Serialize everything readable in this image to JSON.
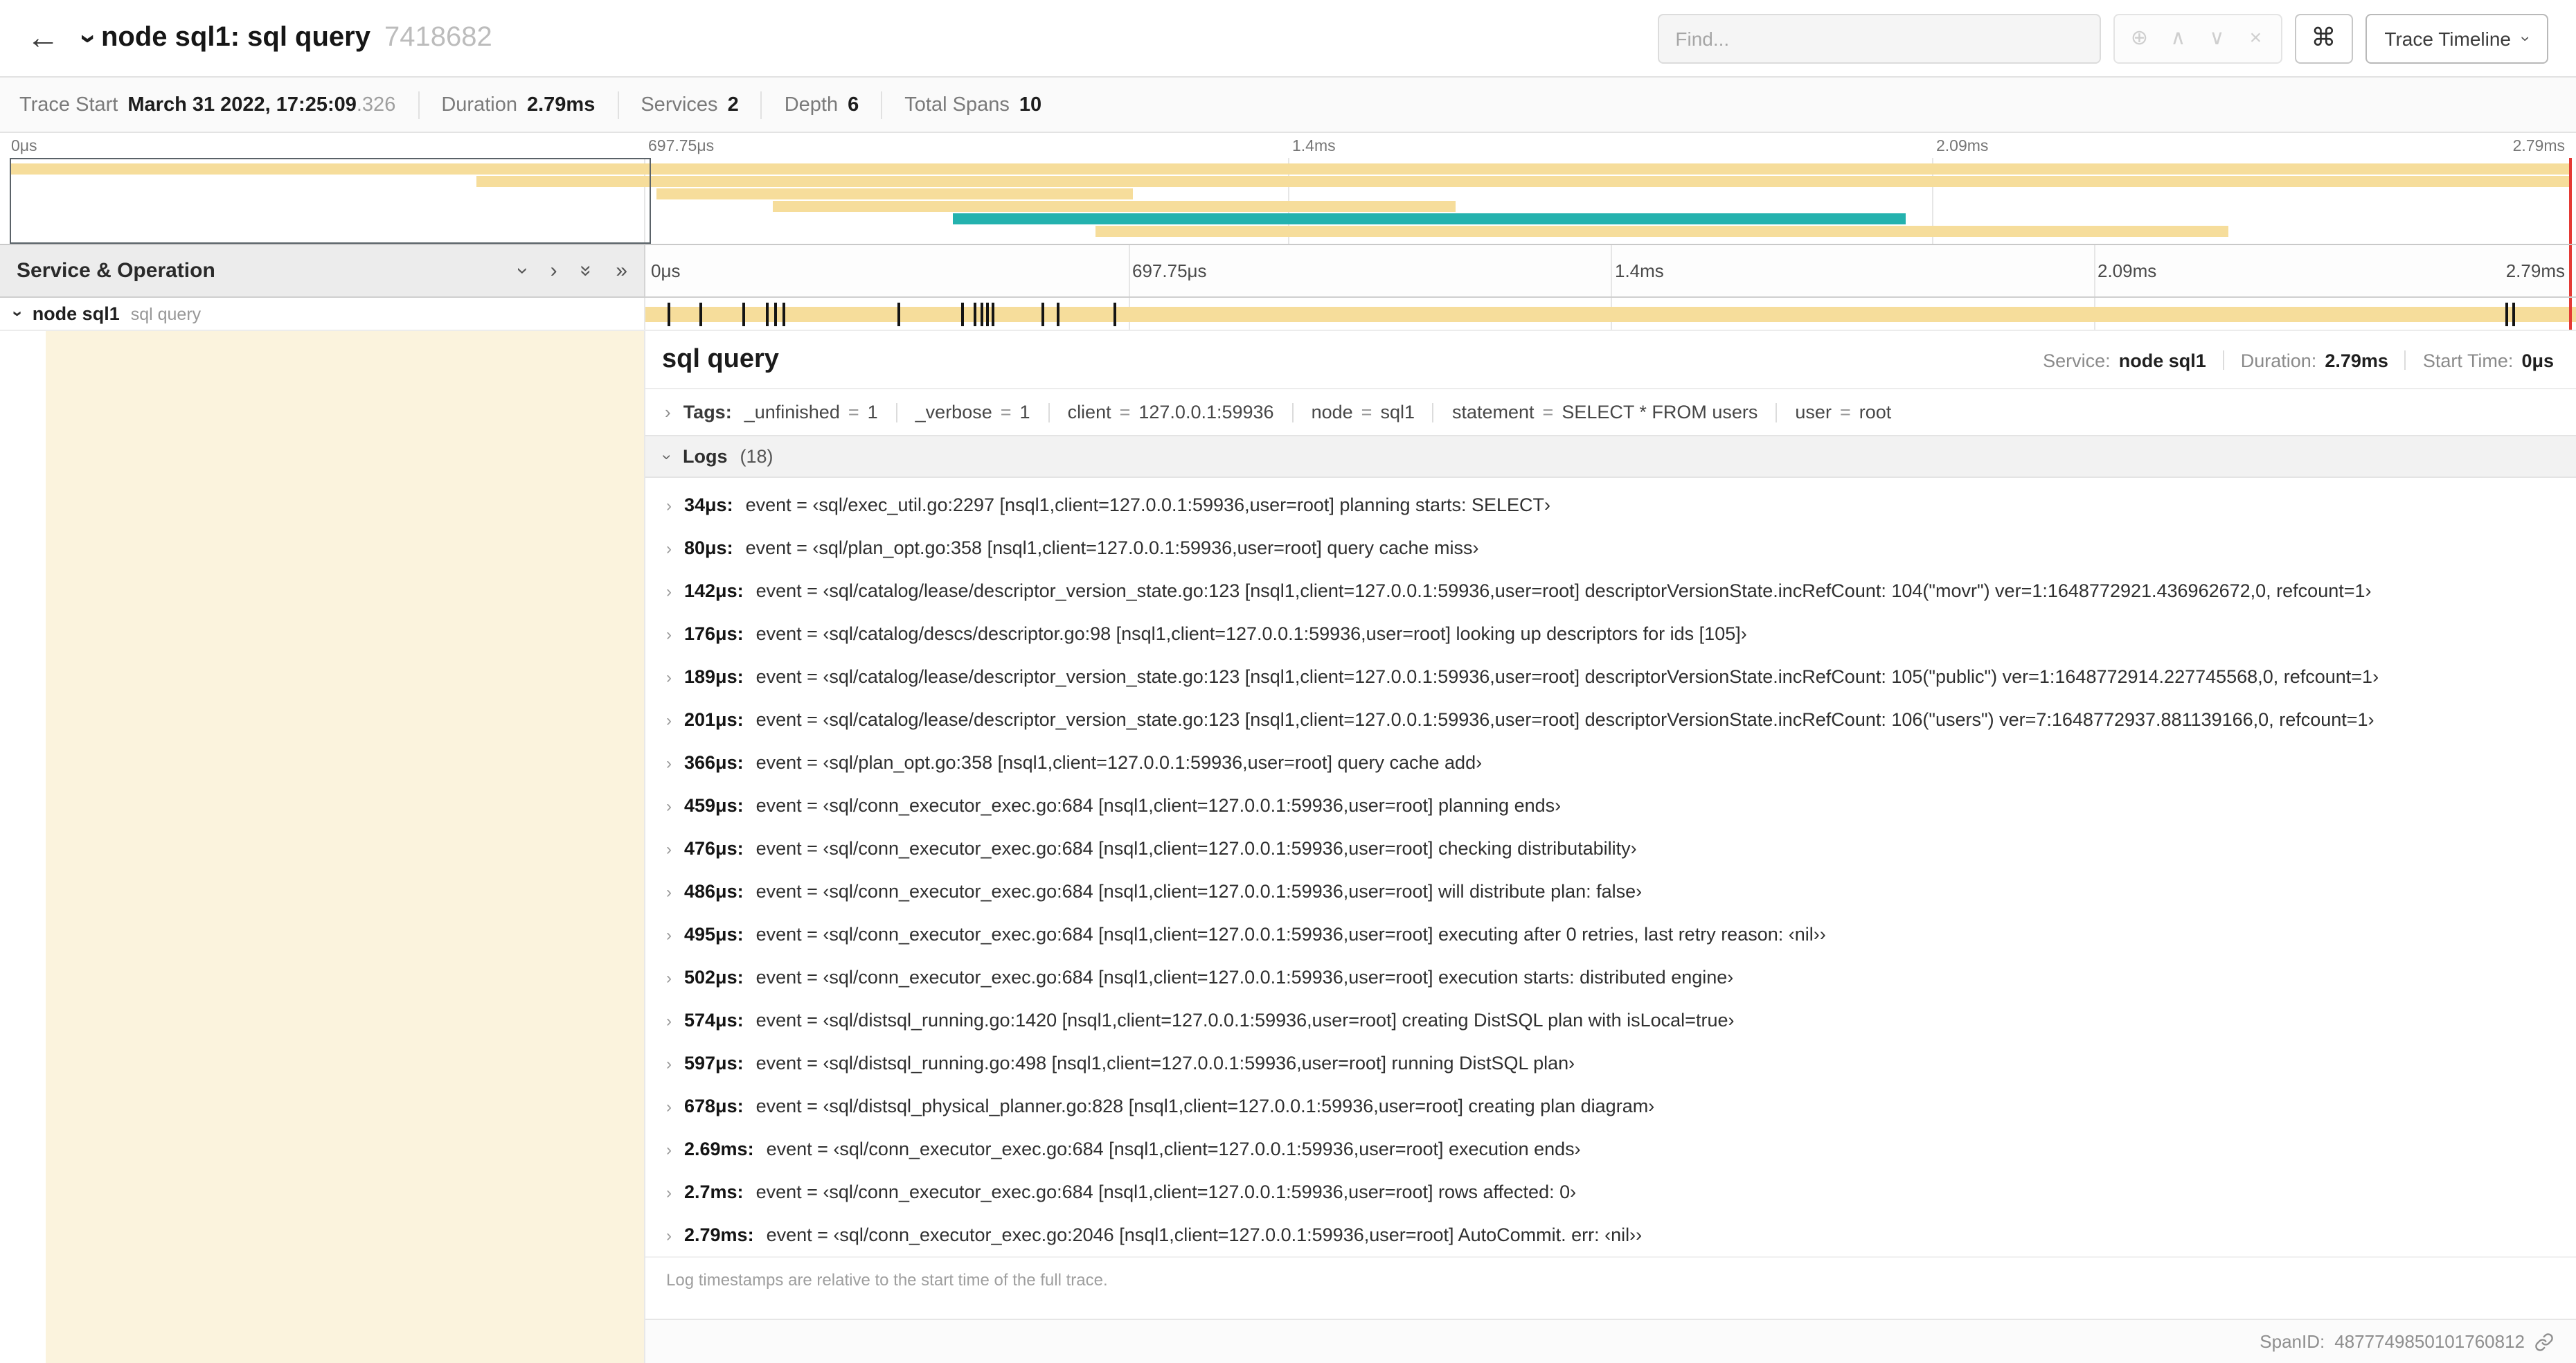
{
  "header": {
    "title": "node sql1: sql query",
    "trace_id": "7418682",
    "find_placeholder": "Find...",
    "trace_timeline_label": "Trace Timeline"
  },
  "icons": {
    "back": "←",
    "chevron": "›",
    "double_chevron": "»",
    "focus": "⊕",
    "prev_match": "∧",
    "next_match": "∨",
    "clear_search": "×",
    "command": "⌘"
  },
  "summary": {
    "items": [
      {
        "label": "Trace Start",
        "value": "March 31 2022, 17:25:09",
        "suffix": ".326"
      },
      {
        "label": "Duration",
        "value": "2.79ms"
      },
      {
        "label": "Services",
        "value": "2"
      },
      {
        "label": "Depth",
        "value": "6"
      },
      {
        "label": "Total Spans",
        "value": "10"
      }
    ]
  },
  "minimap": {
    "ticks": [
      "0μs",
      "697.75μs",
      "1.4ms",
      "2.09ms",
      "2.79ms"
    ],
    "viewport": {
      "start": 0.004,
      "end": 0.2525
    },
    "scrubber": 0.9975,
    "bars": [
      {
        "row": 0,
        "start": 0.004,
        "end": 0.998,
        "color": "tan"
      },
      {
        "row": 1,
        "start": 0.185,
        "end": 0.998,
        "color": "tan"
      },
      {
        "row": 2,
        "start": 0.255,
        "end": 0.44,
        "color": "tan"
      },
      {
        "row": 3,
        "start": 0.3,
        "end": 0.565,
        "color": "tan"
      },
      {
        "row": 4,
        "start": 0.37,
        "end": 0.74,
        "color": "teal"
      },
      {
        "row": 5,
        "start": 0.425,
        "end": 0.865,
        "color": "tan"
      }
    ]
  },
  "timeline": {
    "panel_title": "Service & Operation",
    "ticks": [
      "0μs",
      "697.75μs",
      "1.4ms",
      "2.09ms",
      "2.79ms"
    ],
    "duration_us": 2790,
    "span_row": {
      "service": "node sql1",
      "operation": "sql query",
      "marker_times_us": [
        34,
        80,
        142,
        176,
        189,
        201,
        366,
        459,
        476,
        486,
        495,
        502,
        574,
        597,
        678,
        2690,
        2700,
        2790
      ]
    }
  },
  "detail": {
    "title": "sql query",
    "meta": [
      {
        "label": "Service:",
        "value": "node sql1"
      },
      {
        "label": "Duration:",
        "value": "2.79ms"
      },
      {
        "label": "Start Time:",
        "value": "0μs"
      }
    ],
    "tags_label": "Tags:",
    "tags": [
      {
        "key": "_unfinished",
        "value": "1"
      },
      {
        "key": "_verbose",
        "value": "1"
      },
      {
        "key": "client",
        "value": "127.0.0.1:59936"
      },
      {
        "key": "node",
        "value": "sql1"
      },
      {
        "key": "statement",
        "value": "SELECT * FROM users"
      },
      {
        "key": "user",
        "value": "root"
      }
    ],
    "logs_label": "Logs",
    "logs_count": "(18)",
    "logs": [
      {
        "time": "34μs:",
        "text": "event = ‹sql/exec_util.go:2297 [nsql1,client=127.0.0.1:59936,user=root] planning starts: SELECT›"
      },
      {
        "time": "80μs:",
        "text": "event = ‹sql/plan_opt.go:358 [nsql1,client=127.0.0.1:59936,user=root] query cache miss›"
      },
      {
        "time": "142μs:",
        "text": "event = ‹sql/catalog/lease/descriptor_version_state.go:123 [nsql1,client=127.0.0.1:59936,user=root] descriptorVersionState.incRefCount: 104(\"movr\") ver=1:1648772921.436962672,0, refcount=1›"
      },
      {
        "time": "176μs:",
        "text": "event = ‹sql/catalog/descs/descriptor.go:98 [nsql1,client=127.0.0.1:59936,user=root] looking up descriptors for ids [105]›"
      },
      {
        "time": "189μs:",
        "text": "event = ‹sql/catalog/lease/descriptor_version_state.go:123 [nsql1,client=127.0.0.1:59936,user=root] descriptorVersionState.incRefCount: 105(\"public\") ver=1:1648772914.227745568,0, refcount=1›"
      },
      {
        "time": "201μs:",
        "text": "event = ‹sql/catalog/lease/descriptor_version_state.go:123 [nsql1,client=127.0.0.1:59936,user=root] descriptorVersionState.incRefCount: 106(\"users\") ver=7:1648772937.881139166,0, refcount=1›"
      },
      {
        "time": "366μs:",
        "text": "event = ‹sql/plan_opt.go:358 [nsql1,client=127.0.0.1:59936,user=root] query cache add›"
      },
      {
        "time": "459μs:",
        "text": "event = ‹sql/conn_executor_exec.go:684 [nsql1,client=127.0.0.1:59936,user=root] planning ends›"
      },
      {
        "time": "476μs:",
        "text": "event = ‹sql/conn_executor_exec.go:684 [nsql1,client=127.0.0.1:59936,user=root] checking distributability›"
      },
      {
        "time": "486μs:",
        "text": "event = ‹sql/conn_executor_exec.go:684 [nsql1,client=127.0.0.1:59936,user=root] will distribute plan: false›"
      },
      {
        "time": "495μs:",
        "text": "event = ‹sql/conn_executor_exec.go:684 [nsql1,client=127.0.0.1:59936,user=root] executing after 0 retries, last retry reason: ‹nil››"
      },
      {
        "time": "502μs:",
        "text": "event = ‹sql/conn_executor_exec.go:684 [nsql1,client=127.0.0.1:59936,user=root] execution starts: distributed engine›"
      },
      {
        "time": "574μs:",
        "text": "event = ‹sql/distsql_running.go:1420 [nsql1,client=127.0.0.1:59936,user=root] creating DistSQL plan with isLocal=true›"
      },
      {
        "time": "597μs:",
        "text": "event = ‹sql/distsql_running.go:498 [nsql1,client=127.0.0.1:59936,user=root] running DistSQL plan›"
      },
      {
        "time": "678μs:",
        "text": "event = ‹sql/distsql_physical_planner.go:828 [nsql1,client=127.0.0.1:59936,user=root] creating plan diagram›"
      },
      {
        "time": "2.69ms:",
        "text": "event = ‹sql/conn_executor_exec.go:684 [nsql1,client=127.0.0.1:59936,user=root] execution ends›"
      },
      {
        "time": "2.7ms:",
        "text": "event = ‹sql/conn_executor_exec.go:684 [nsql1,client=127.0.0.1:59936,user=root] rows affected: 0›"
      },
      {
        "time": "2.79ms:",
        "text": "event = ‹sql/conn_executor_exec.go:2046 [nsql1,client=127.0.0.1:59936,user=root] AutoCommit. err: ‹nil››"
      }
    ],
    "footer_note": "Log timestamps are relative to the start time of the full trace.",
    "span_id_label": "SpanID:",
    "span_id": "4877749850101760812"
  },
  "colors": {
    "tan": "#f6dd9b",
    "teal": "#24b2ae",
    "cream": "#fbf3dd",
    "red": "#e53935"
  }
}
